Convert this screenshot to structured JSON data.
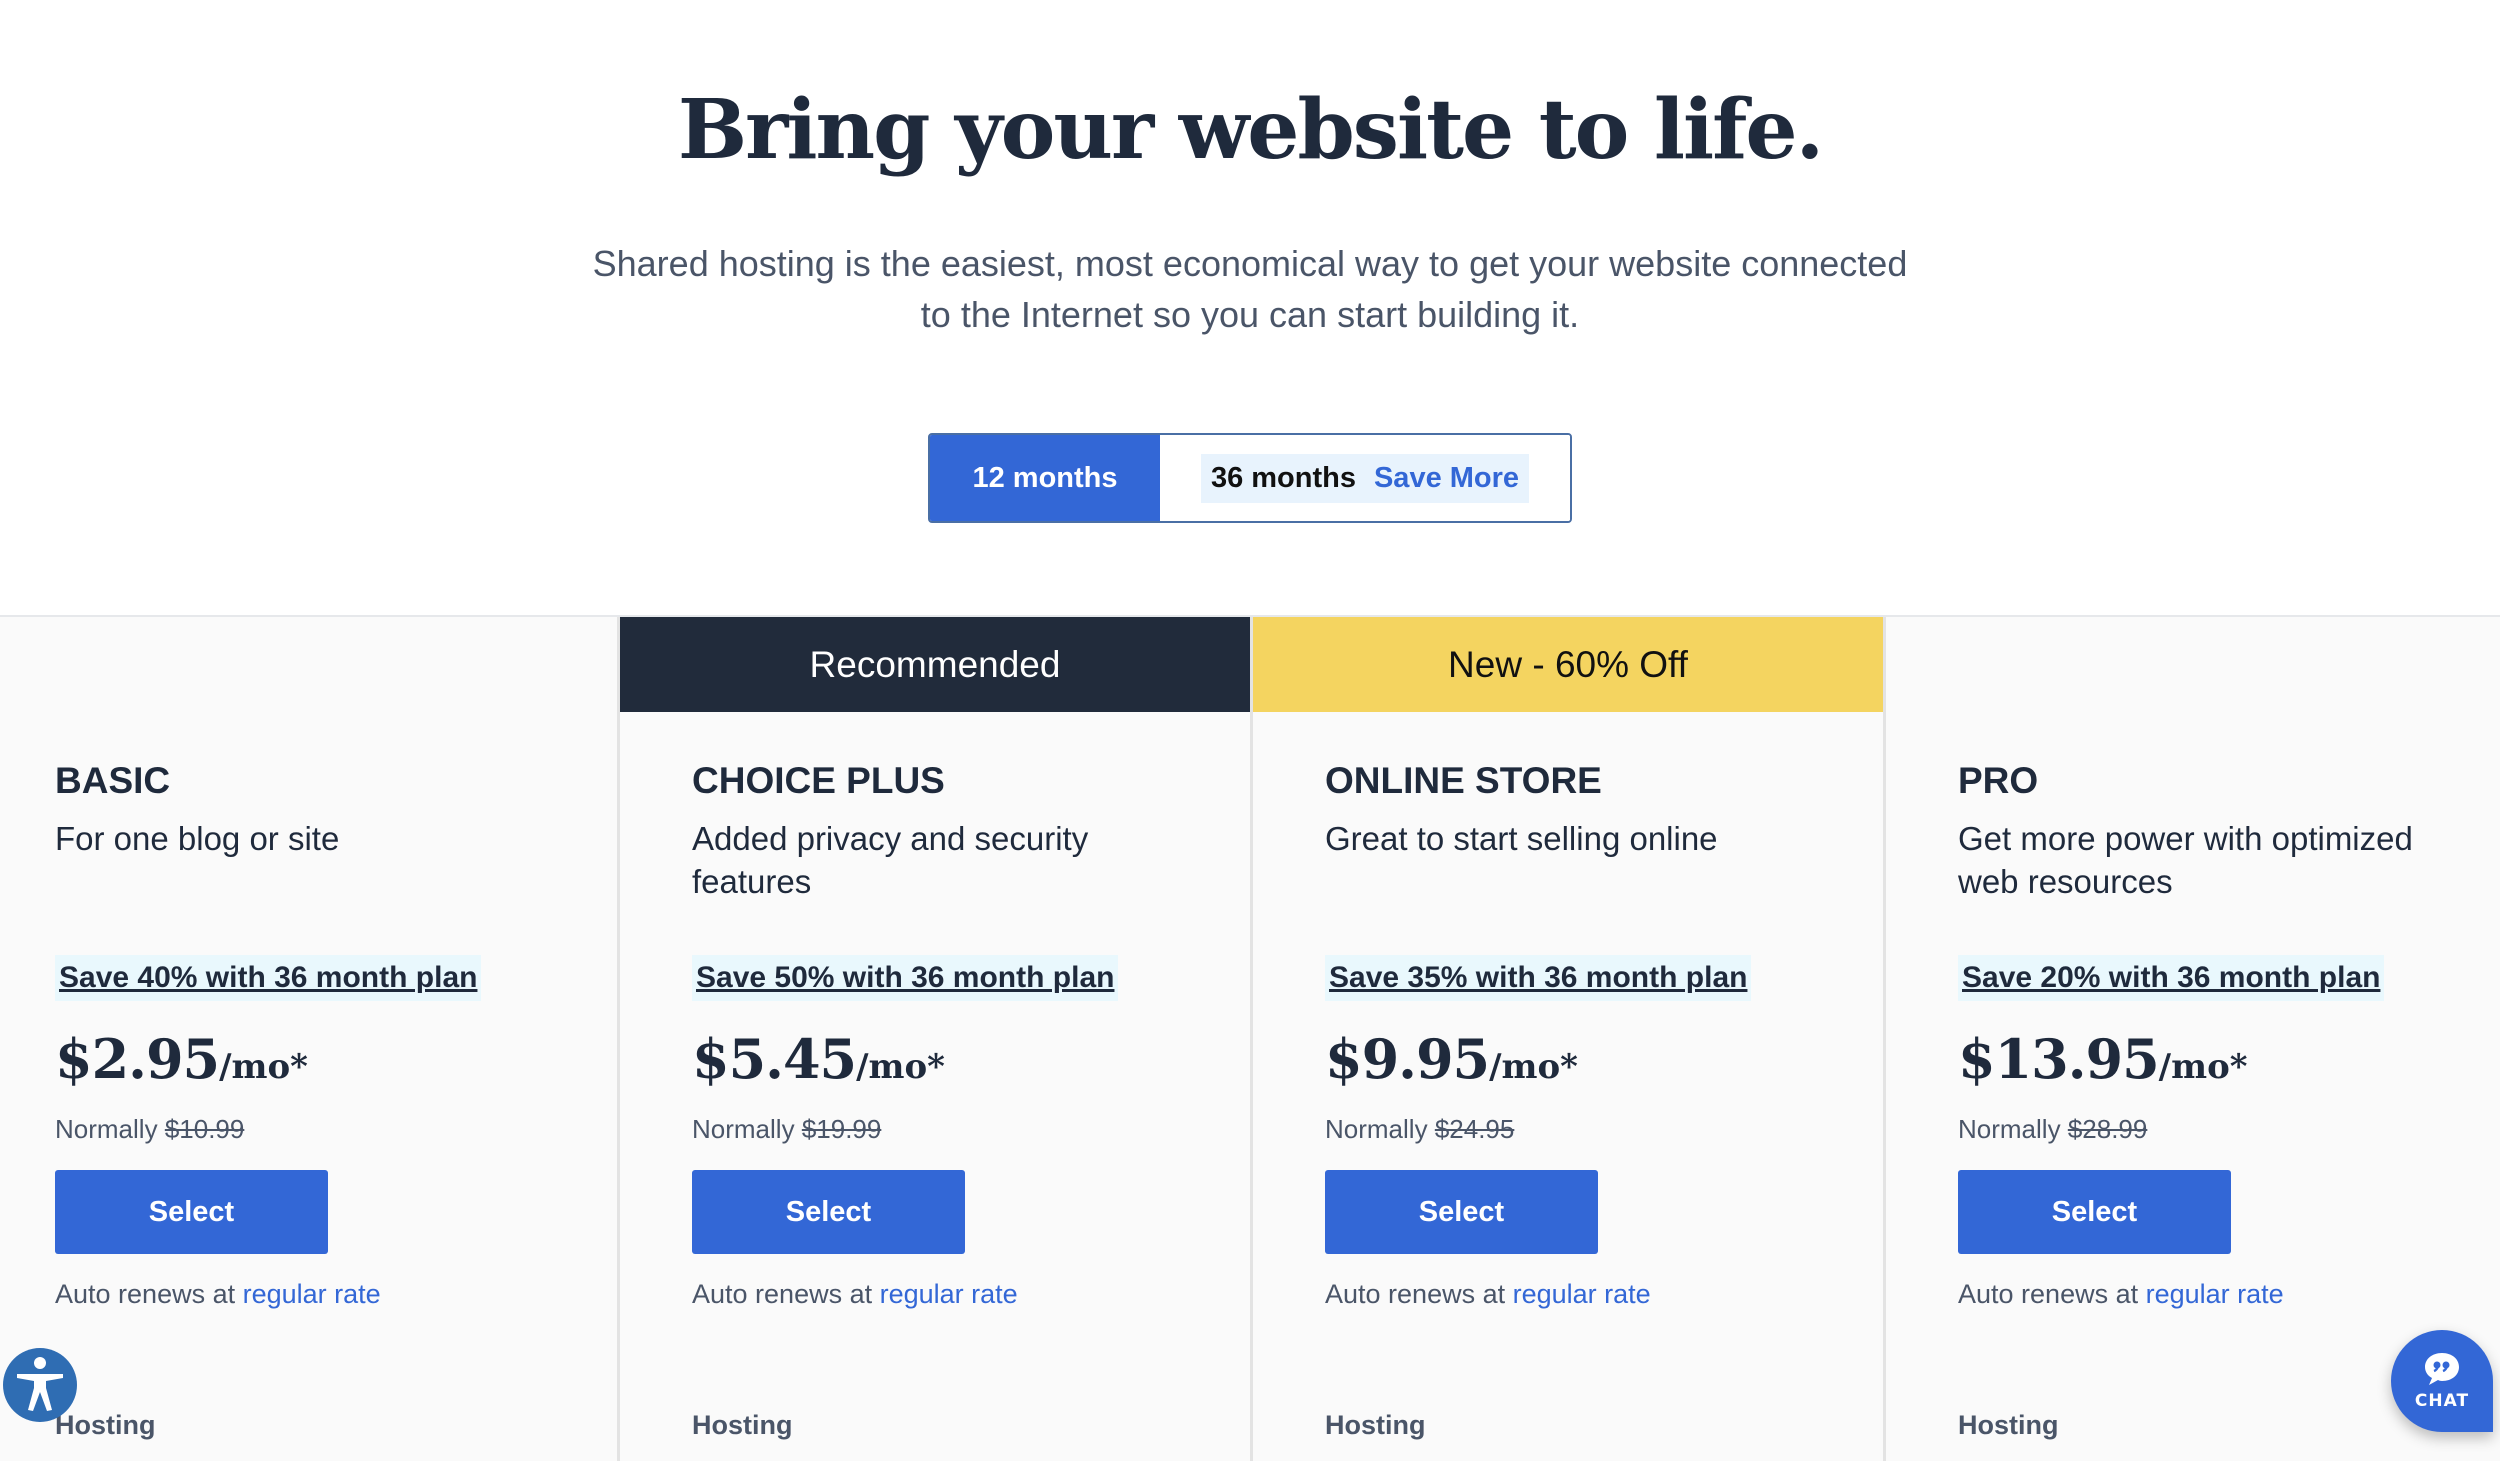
{
  "hero": {
    "title": "Bring your website to life.",
    "subtitle_line1": "Shared hosting is the easiest, most economical way to get your website connected",
    "subtitle_line2": "to the Internet so you can start building it."
  },
  "term_toggle": {
    "options": [
      {
        "label": "12 months",
        "selected": true
      },
      {
        "label": "36 months",
        "badge": "Save More",
        "selected": false
      }
    ]
  },
  "colors": {
    "primary": "#3367d6",
    "dark_navy": "#212b3b",
    "highlight_yellow": "#f4d460",
    "save_highlight": "#e9f8fd"
  },
  "plans": [
    {
      "ribbon": "",
      "name": "BASIC",
      "description": "For one blog or site",
      "save_text": "Save 40% with 36 month plan",
      "price": "$2.95",
      "price_unit": "/mo*",
      "normally_label": "Normally",
      "normal_price": "$10.99",
      "select_label": "Select",
      "auto_renew_text": "Auto renews at",
      "auto_renew_link": "regular rate",
      "section_label": "Hosting"
    },
    {
      "ribbon": "Recommended",
      "name": "CHOICE PLUS",
      "description": "Added privacy and security features",
      "save_text": "Save 50% with 36 month plan",
      "price": "$5.45",
      "price_unit": "/mo*",
      "normally_label": "Normally",
      "normal_price": "$19.99",
      "select_label": "Select",
      "auto_renew_text": "Auto renews at",
      "auto_renew_link": "regular rate",
      "section_label": "Hosting"
    },
    {
      "ribbon": "New - 60% Off",
      "name": "ONLINE STORE",
      "description": "Great to start selling online",
      "save_text": "Save 35% with 36 month plan",
      "price": "$9.95",
      "price_unit": "/mo*",
      "normally_label": "Normally",
      "normal_price": "$24.95",
      "select_label": "Select",
      "auto_renew_text": "Auto renews at",
      "auto_renew_link": "regular rate",
      "section_label": "Hosting"
    },
    {
      "ribbon": "",
      "name": "PRO",
      "description": "Get more power with optimized web resources",
      "save_text": "Save 20% with 36 month plan",
      "price": "$13.95",
      "price_unit": "/mo*",
      "normally_label": "Normally",
      "normal_price": "$28.99",
      "select_label": "Select",
      "auto_renew_text": "Auto renews at",
      "auto_renew_link": "regular rate",
      "section_label": "Hosting"
    }
  ],
  "widgets": {
    "accessibility_icon": "accessibility-icon",
    "chat_label": "CHAT",
    "chat_icon": "chat-bubble-quote-icon"
  }
}
